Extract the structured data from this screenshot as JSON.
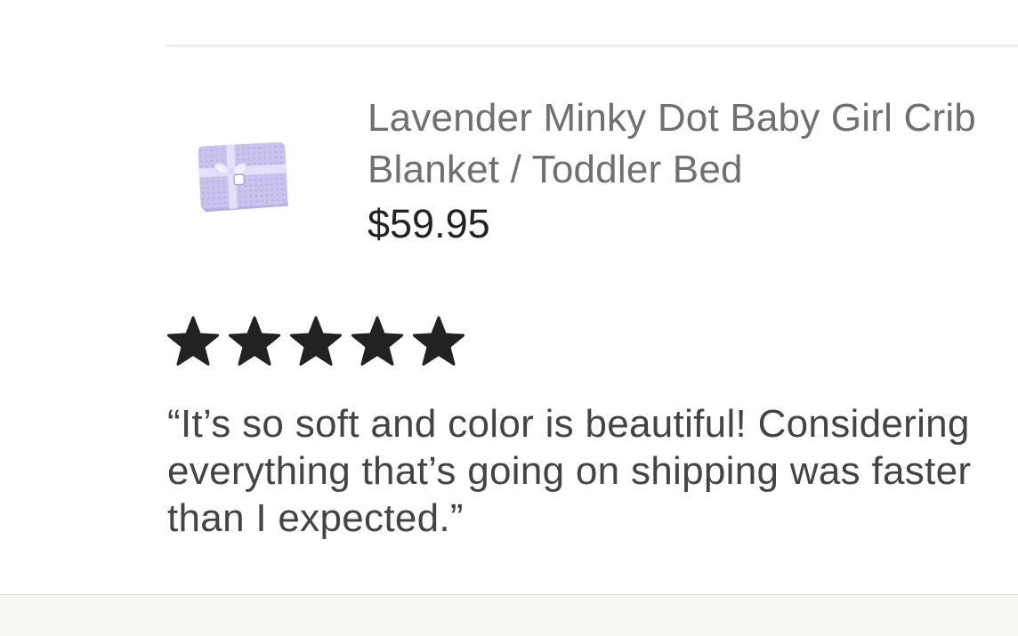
{
  "product": {
    "title": "Lavender Minky Dot Baby Girl Crib Blanket / Toddler Bed",
    "price": "$59.95",
    "image_icon": "lavender-blanket-image"
  },
  "review": {
    "rating": 5,
    "rating_max": 5,
    "text": "“It’s so soft and color is beautiful! Considering everything that’s going on shipping was faster than I expected.”"
  },
  "colors": {
    "title": "#707070",
    "price": "#222222",
    "star": "#222222",
    "review": "#444444",
    "blanket": "#c9c0ec",
    "footer_background": "#f6f6f2"
  }
}
